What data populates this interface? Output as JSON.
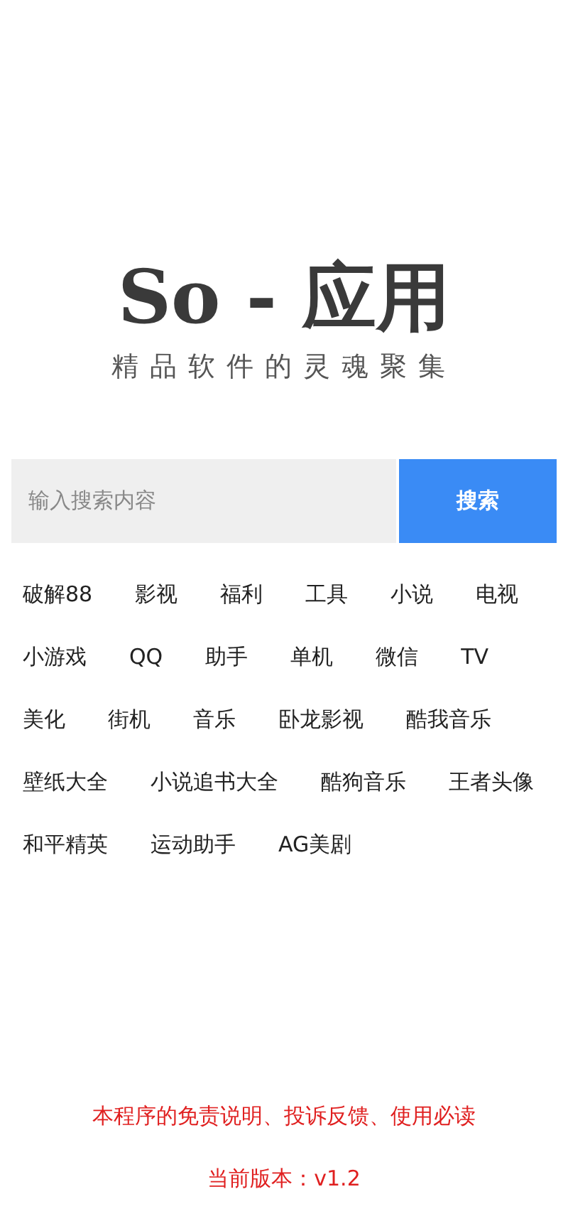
{
  "logo": {
    "title": "So - 应用",
    "slogan": "精品软件的灵魂聚集"
  },
  "search": {
    "placeholder": "输入搜索内容",
    "button": "搜索"
  },
  "tag_rows": [
    [
      "破解88",
      "影视",
      "福利",
      "工具",
      "小说",
      "电视"
    ],
    [
      "小游戏",
      "QQ",
      "助手",
      "单机",
      "微信",
      "TV"
    ],
    [
      "美化",
      "街机",
      "音乐",
      "卧龙影视",
      "酷我音乐"
    ],
    [
      "壁纸大全",
      "小说追书大全",
      "酷狗音乐",
      "王者头像"
    ],
    [
      "和平精英",
      "运动助手",
      "AG美剧"
    ]
  ],
  "footer": {
    "notice_link": "本程序的免责说明、投诉反馈、使用必读",
    "version": "当前版本：v1.2"
  }
}
